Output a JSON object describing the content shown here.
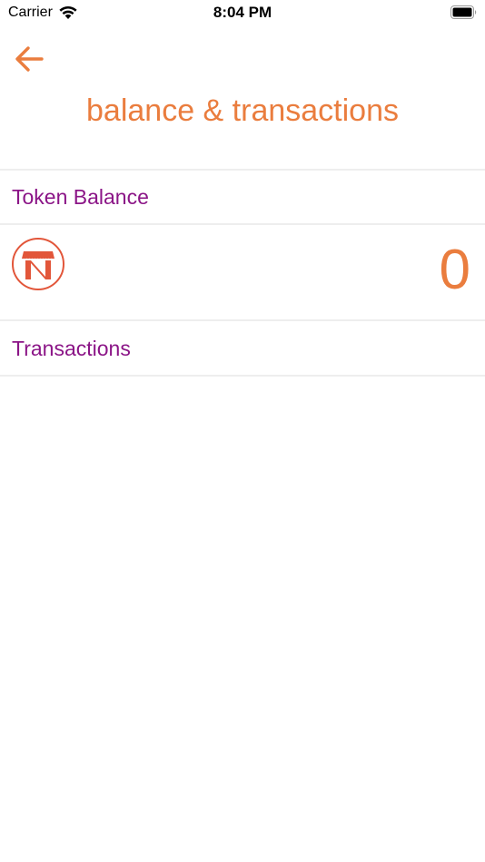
{
  "status_bar": {
    "carrier": "Carrier",
    "time": "8:04 PM"
  },
  "header": {
    "back_icon": "arrow-left-icon",
    "title": "balance & transactions"
  },
  "token_balance": {
    "label": "Token Balance",
    "logo_icon": "store-logo-icon",
    "value": "0"
  },
  "transactions": {
    "label": "Transactions"
  },
  "colors": {
    "accent": "#ea7d3e",
    "section_label": "#8b1587",
    "logo": "#e2563a",
    "divider": "#eeeeee"
  }
}
